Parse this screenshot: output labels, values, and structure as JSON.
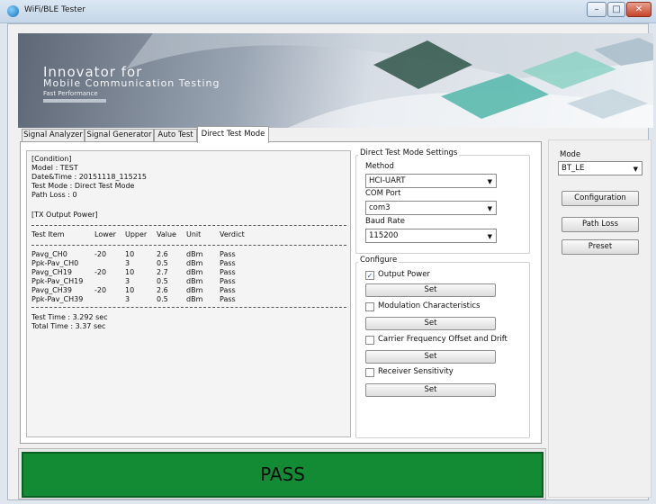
{
  "window": {
    "title": "WiFi/BLE Tester",
    "controls": {
      "minimize": "–",
      "maximize": "□",
      "close": "✕"
    }
  },
  "banner": {
    "line1": "Innovator for",
    "line2": "Mobile Communication Testing",
    "line3": "Fast Performance"
  },
  "tabs": [
    "Signal Analyzer",
    "Signal Generator",
    "Auto Test",
    "Direct Test Mode"
  ],
  "report": {
    "condition_header": "[Condition]",
    "model": "Model      : TEST",
    "datetime": "Date&Time  : 20151118_115215",
    "test_mode": "Test Mode   : Direct Test Mode",
    "path_loss": "Path Loss   : 0",
    "tx_header": "[TX Output Power]",
    "columns": [
      "Test Item",
      "Lower",
      "Upper",
      "Value",
      "Unit",
      "Verdict"
    ],
    "rows": [
      [
        "Pavg_CH0",
        "-20",
        "10",
        "2.6",
        "dBm",
        "Pass"
      ],
      [
        "Ppk-Pav_CH0",
        "",
        "3",
        "0.5",
        "dBm",
        "Pass"
      ],
      [
        "Pavg_CH19",
        "-20",
        "10",
        "2.7",
        "dBm",
        "Pass"
      ],
      [
        "Ppk-Pav_CH19",
        "",
        "3",
        "0.5",
        "dBm",
        "Pass"
      ],
      [
        "Pavg_CH39",
        "-20",
        "10",
        "2.6",
        "dBm",
        "Pass"
      ],
      [
        "Ppk-Pav_CH39",
        "",
        "3",
        "0.5",
        "dBm",
        "Pass"
      ]
    ],
    "test_time": "Test Time   : 3.292 sec",
    "total_time": "Total Time  : 3.37 sec"
  },
  "dtm_settings": {
    "title": "Direct Test Mode Settings",
    "method_label": "Method",
    "method_value": "HCI-UART",
    "com_port_label": "COM Port",
    "com_port_value": "com3",
    "baud_rate_label": "Baud Rate",
    "baud_rate_value": "115200"
  },
  "configure": {
    "title": "Configure",
    "items": [
      {
        "label": "Output Power",
        "checked": true,
        "button": "Set"
      },
      {
        "label": "Modulation Characteristics",
        "checked": false,
        "button": "Set"
      },
      {
        "label": "Carrier Frequency Offset and Drift",
        "checked": false,
        "button": "Set"
      },
      {
        "label": "Receiver Sensitivity",
        "checked": false,
        "button": "Set"
      }
    ]
  },
  "right_panel": {
    "mode_label": "Mode",
    "mode_value": "BT_LE",
    "configuration_button": "Configuration",
    "path_loss_button": "Path Loss",
    "preset_button": "Preset"
  },
  "result": {
    "text": "PASS",
    "color": "#138b35"
  }
}
